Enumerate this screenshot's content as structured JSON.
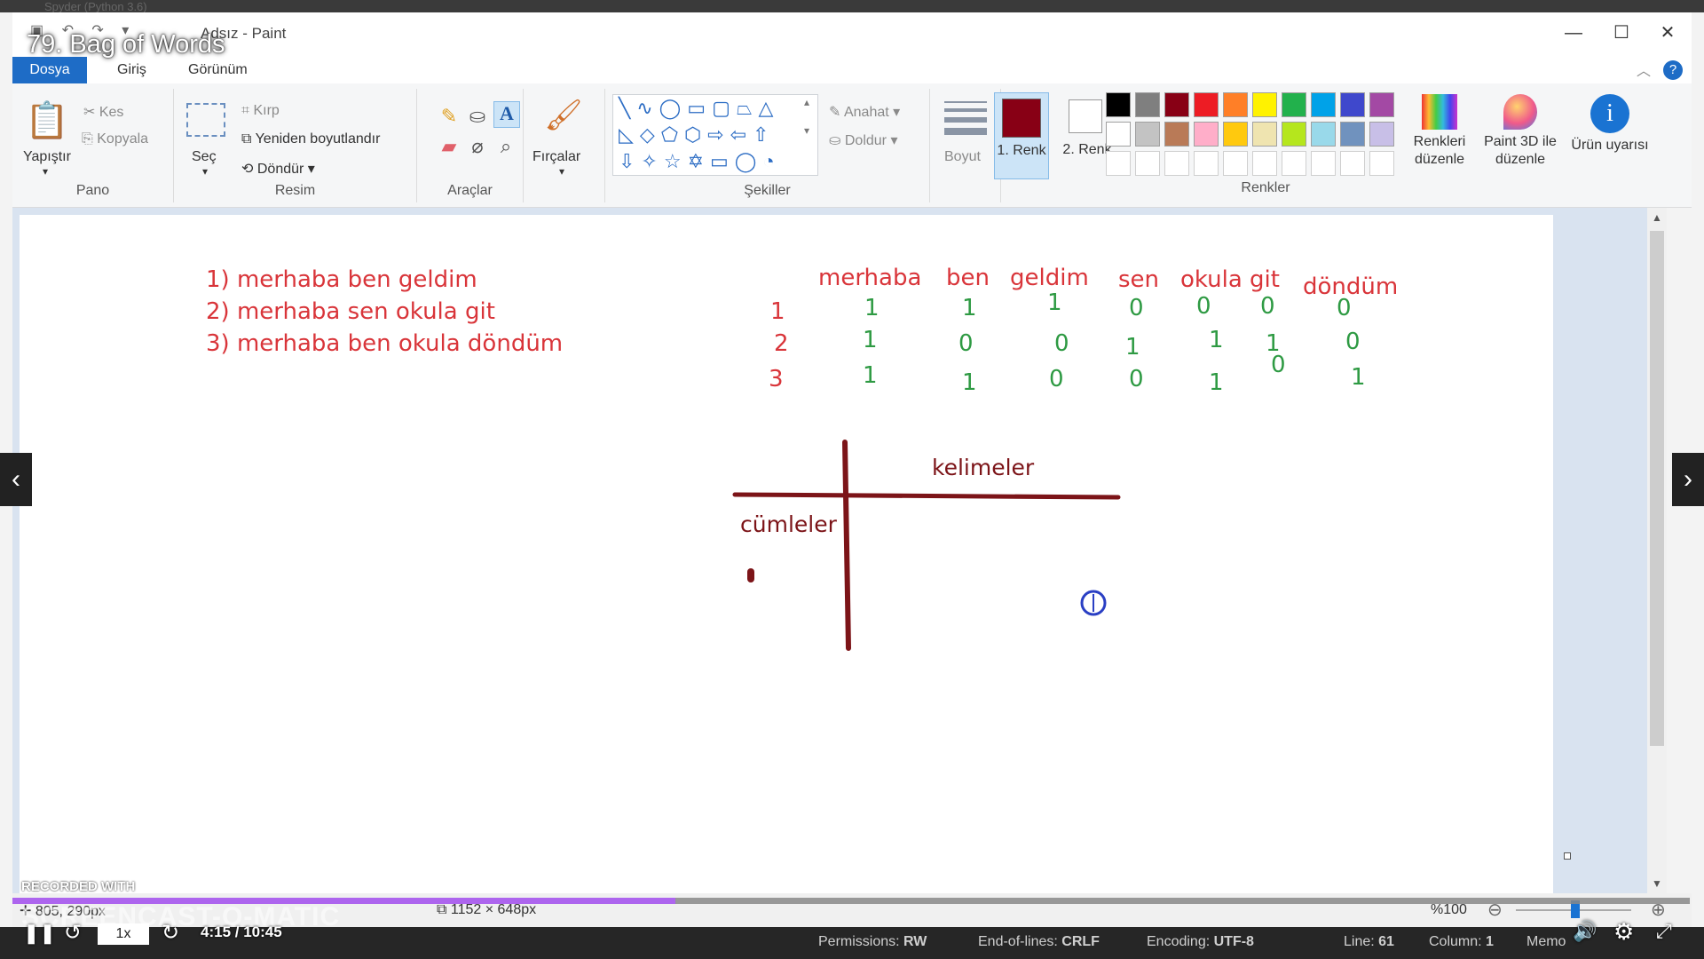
{
  "window": {
    "background_app_title": "Spyder (Python 3.6)",
    "title": "Adsız - Paint",
    "video_title": "79. Bag of Words"
  },
  "tabs": [
    {
      "label": "Dosya"
    },
    {
      "label": "Giriş"
    },
    {
      "label": "Görünüm"
    }
  ],
  "ribbon": {
    "pano": {
      "label": "Pano",
      "paste": "Yapıştır",
      "cut": "Kes",
      "copy": "Kopyala"
    },
    "resim": {
      "label": "Resim",
      "select": "Seç",
      "crop": "Kırp",
      "resize": "Yeniden boyutlandır",
      "rotate": "Döndür"
    },
    "araclar": {
      "label": "Araçlar"
    },
    "brushes": "Fırçalar",
    "sekiller": {
      "label": "Şekiller",
      "outline": "Anahat",
      "fill": "Doldur"
    },
    "size": "Boyut",
    "color1": "1. Renk",
    "color2": "2. Renk",
    "renkler": {
      "label": "Renkler",
      "edit_colors": "Renkleri düzenle"
    },
    "paint3d": "Paint 3D ile düzenle",
    "product_alert": "Ürün uyarısı",
    "palette_row1": [
      "#000000",
      "#7f7f7f",
      "#880015",
      "#ed1c24",
      "#ff7f27",
      "#fff200",
      "#22b14c",
      "#00a2e8",
      "#3f48cc",
      "#a349a4"
    ],
    "palette_row2": [
      "#ffffff",
      "#c3c3c3",
      "#b97a57",
      "#ffaec9",
      "#ffc90e",
      "#efe4b0",
      "#b5e61d",
      "#99d9ea",
      "#7092be",
      "#c8bfe7"
    ],
    "color1_value": "#880015",
    "color2_value": "#ffffff"
  },
  "canvas": {
    "sentences": [
      "1) merhaba ben geldim",
      "2) merhaba sen okula git",
      "3) merhaba ben okula döndüm"
    ],
    "words": [
      "merhaba",
      "ben",
      "geldim",
      "sen",
      "okula",
      "git",
      "döndüm"
    ],
    "row_labels": [
      "1",
      "2",
      "3"
    ],
    "matrix": [
      [
        "1",
        "1",
        "1",
        "0",
        "0",
        "0",
        "0"
      ],
      [
        "1",
        "0",
        "0",
        "1",
        "1",
        "1",
        "0"
      ],
      [
        "1",
        "1",
        "0",
        "0",
        "1",
        "0",
        "1"
      ]
    ],
    "axis_words": "kelimeler",
    "axis_sentences": "cümleler"
  },
  "statusbar": {
    "cursor_pos": "805, 290px",
    "canvas_size": "1152 × 648px",
    "zoom": "%100"
  },
  "editor_status": {
    "permissions_label": "Permissions:",
    "permissions": "RW",
    "eol_label": "End-of-lines:",
    "eol": "CRLF",
    "encoding_label": "Encoding:",
    "encoding": "UTF-8",
    "line_label": "Line:",
    "line": "61",
    "column_label": "Column:",
    "column": "1",
    "memory_label": "Memo"
  },
  "player": {
    "speed": "1x",
    "time": "4:15 / 10:45",
    "progress": 0.395,
    "watermark_top": "RECORDED WITH",
    "watermark": "SCREENCAST-O-MATIC"
  }
}
